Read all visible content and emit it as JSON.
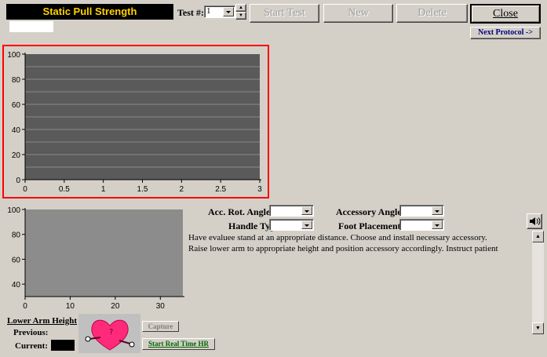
{
  "header": {
    "title": "Static Pull Strength",
    "test_label": "Test #:",
    "test_value": "1",
    "start_test": "Start Test",
    "new": "New",
    "delete": "Delete",
    "close": "Close",
    "next_protocol": "Next Protocol ->"
  },
  "chart_data": [
    {
      "type": "line",
      "title": "",
      "xlabel": "",
      "ylabel": "",
      "xlim": [
        0,
        3
      ],
      "ylim": [
        0,
        100
      ],
      "xticks": [
        "0",
        "0.5",
        "1",
        "1.5",
        "2",
        "2.5",
        "3"
      ],
      "yticks": [
        "0",
        "20",
        "40",
        "60",
        "80",
        "100"
      ],
      "series": [],
      "grid": true,
      "colors": {
        "plot_bg": "#5a5a5a",
        "grid": "#8a8a8a",
        "highlight_border": "#ff0000"
      }
    },
    {
      "type": "line",
      "title": "",
      "xlabel": "",
      "ylabel": "",
      "xlim": [
        0,
        35
      ],
      "ylim": [
        30,
        100
      ],
      "xticks": [
        "0",
        "10",
        "20",
        "30"
      ],
      "yticks": [
        "40",
        "60",
        "80",
        "100"
      ],
      "series": [],
      "grid": false,
      "colors": {
        "plot_bg": "#8c8c8c"
      }
    }
  ],
  "controls": {
    "acc_rot_angle_label": "Acc. Rot. Angle",
    "accessory_angle_label": "Accessory Angle",
    "handle_type_label": "Handle Type",
    "foot_placement_label": "Foot Placement"
  },
  "instructions": {
    "line1": "Have evaluee stand at an appropriate distance.  Choose and install necessary accessory.",
    "line2": "Raise lower arm to appropriate height and position accessory accordingly.  Instruct patient"
  },
  "bottom": {
    "lower_arm_height": "Lower Arm Height",
    "previous_label": "Previous:",
    "current_label": "Current:",
    "capture": "Capture",
    "start_hr": "Start Real Time HR"
  },
  "icons": {
    "speaker": "speaker-icon",
    "heart": "heart-mascot-icon"
  }
}
